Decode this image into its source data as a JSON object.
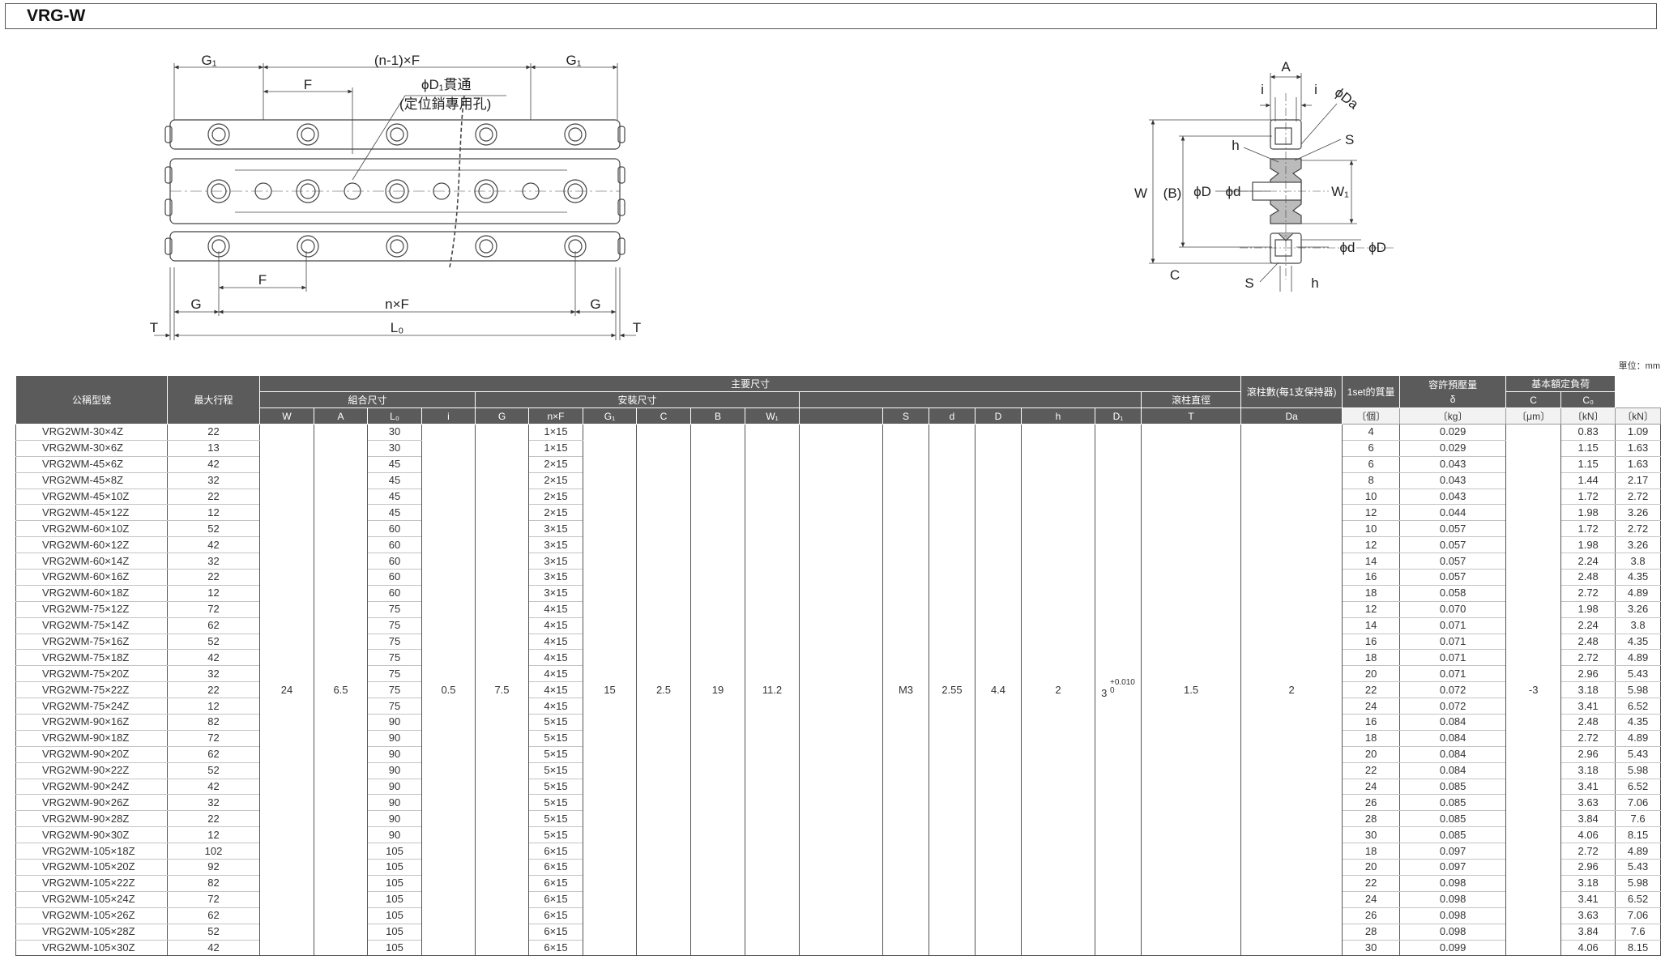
{
  "page_title": "VRG-W",
  "unit_label": "單位：mm",
  "drawing_labels": {
    "g1": "G₁",
    "n1f": "(n-1)×F",
    "f": "F",
    "d1": "ϕD₁貫通",
    "d1_note": "(定位銷專用孔)",
    "g": "G",
    "nxf": "n×F",
    "l0": "L₀",
    "t": "T",
    "a": "A",
    "i": "i",
    "da": "ϕDa",
    "h": "h",
    "s": "S",
    "w": "W",
    "b": "(B)",
    "phi_d_big": "ϕD",
    "phi_d_small": "ϕd",
    "w1": "W₁",
    "c": "C"
  },
  "headers": {
    "model": "公稱型號",
    "stroke": "最大行程",
    "main_dims": "主要尺寸",
    "assembly": "組合尺寸",
    "mounting": "安裝尺寸",
    "roller_dia": "滾柱直徑",
    "roller_count": "滾柱數(每1支保持器)",
    "roller_count_unit": "〔個〕",
    "mass": "1set的質量",
    "mass_unit": "〔kg〕",
    "preload": "容許預壓量",
    "preload_sym": "δ",
    "preload_unit": "〔μm〕",
    "load": "基本額定負荷",
    "load_unit": "〔kN〕",
    "cols": [
      "W",
      "A",
      "L₀",
      "i",
      "G",
      "n×F",
      "G₁",
      "C",
      "B",
      "W₁",
      "S",
      "d",
      "D",
      "h",
      "D₁",
      "T",
      "Da",
      "C",
      "C₀"
    ]
  },
  "common": {
    "W": "24",
    "A": "6.5",
    "i": "0.5",
    "G": "7.5",
    "G1": "15",
    "C": "2.5",
    "B": "19",
    "W1": "11.2",
    "S": "M3",
    "d": "2.55",
    "D": "4.4",
    "h": "2",
    "D1_base": "3",
    "D1_tol_upper": "+0.010",
    "D1_tol_lower": "0",
    "T": "1.5",
    "Da": "2",
    "preload": "-3"
  },
  "rows": [
    {
      "model": "VRG2WM-30×4Z",
      "stroke": "22",
      "L0": "30",
      "nF": "1×15",
      "count": "4",
      "mass": "0.029",
      "C": "0.83",
      "C0": "1.09"
    },
    {
      "model": "VRG2WM-30×6Z",
      "stroke": "13",
      "L0": "30",
      "nF": "1×15",
      "count": "6",
      "mass": "0.029",
      "C": "1.15",
      "C0": "1.63"
    },
    {
      "model": "VRG2WM-45×6Z",
      "stroke": "42",
      "L0": "45",
      "nF": "2×15",
      "count": "6",
      "mass": "0.043",
      "C": "1.15",
      "C0": "1.63"
    },
    {
      "model": "VRG2WM-45×8Z",
      "stroke": "32",
      "L0": "45",
      "nF": "2×15",
      "count": "8",
      "mass": "0.043",
      "C": "1.44",
      "C0": "2.17"
    },
    {
      "model": "VRG2WM-45×10Z",
      "stroke": "22",
      "L0": "45",
      "nF": "2×15",
      "count": "10",
      "mass": "0.043",
      "C": "1.72",
      "C0": "2.72"
    },
    {
      "model": "VRG2WM-45×12Z",
      "stroke": "12",
      "L0": "45",
      "nF": "2×15",
      "count": "12",
      "mass": "0.044",
      "C": "1.98",
      "C0": "3.26"
    },
    {
      "model": "VRG2WM-60×10Z",
      "stroke": "52",
      "L0": "60",
      "nF": "3×15",
      "count": "10",
      "mass": "0.057",
      "C": "1.72",
      "C0": "2.72"
    },
    {
      "model": "VRG2WM-60×12Z",
      "stroke": "42",
      "L0": "60",
      "nF": "3×15",
      "count": "12",
      "mass": "0.057",
      "C": "1.98",
      "C0": "3.26"
    },
    {
      "model": "VRG2WM-60×14Z",
      "stroke": "32",
      "L0": "60",
      "nF": "3×15",
      "count": "14",
      "mass": "0.057",
      "C": "2.24",
      "C0": "3.8"
    },
    {
      "model": "VRG2WM-60×16Z",
      "stroke": "22",
      "L0": "60",
      "nF": "3×15",
      "count": "16",
      "mass": "0.057",
      "C": "2.48",
      "C0": "4.35"
    },
    {
      "model": "VRG2WM-60×18Z",
      "stroke": "12",
      "L0": "60",
      "nF": "3×15",
      "count": "18",
      "mass": "0.058",
      "C": "2.72",
      "C0": "4.89"
    },
    {
      "model": "VRG2WM-75×12Z",
      "stroke": "72",
      "L0": "75",
      "nF": "4×15",
      "count": "12",
      "mass": "0.070",
      "C": "1.98",
      "C0": "3.26"
    },
    {
      "model": "VRG2WM-75×14Z",
      "stroke": "62",
      "L0": "75",
      "nF": "4×15",
      "count": "14",
      "mass": "0.071",
      "C": "2.24",
      "C0": "3.8"
    },
    {
      "model": "VRG2WM-75×16Z",
      "stroke": "52",
      "L0": "75",
      "nF": "4×15",
      "count": "16",
      "mass": "0.071",
      "C": "2.48",
      "C0": "4.35"
    },
    {
      "model": "VRG2WM-75×18Z",
      "stroke": "42",
      "L0": "75",
      "nF": "4×15",
      "count": "18",
      "mass": "0.071",
      "C": "2.72",
      "C0": "4.89"
    },
    {
      "model": "VRG2WM-75×20Z",
      "stroke": "32",
      "L0": "75",
      "nF": "4×15",
      "count": "20",
      "mass": "0.071",
      "C": "2.96",
      "C0": "5.43"
    },
    {
      "model": "VRG2WM-75×22Z",
      "stroke": "22",
      "L0": "75",
      "nF": "4×15",
      "count": "22",
      "mass": "0.072",
      "C": "3.18",
      "C0": "5.98"
    },
    {
      "model": "VRG2WM-75×24Z",
      "stroke": "12",
      "L0": "75",
      "nF": "4×15",
      "count": "24",
      "mass": "0.072",
      "C": "3.41",
      "C0": "6.52"
    },
    {
      "model": "VRG2WM-90×16Z",
      "stroke": "82",
      "L0": "90",
      "nF": "5×15",
      "count": "16",
      "mass": "0.084",
      "C": "2.48",
      "C0": "4.35"
    },
    {
      "model": "VRG2WM-90×18Z",
      "stroke": "72",
      "L0": "90",
      "nF": "5×15",
      "count": "18",
      "mass": "0.084",
      "C": "2.72",
      "C0": "4.89"
    },
    {
      "model": "VRG2WM-90×20Z",
      "stroke": "62",
      "L0": "90",
      "nF": "5×15",
      "count": "20",
      "mass": "0.084",
      "C": "2.96",
      "C0": "5.43"
    },
    {
      "model": "VRG2WM-90×22Z",
      "stroke": "52",
      "L0": "90",
      "nF": "5×15",
      "count": "22",
      "mass": "0.084",
      "C": "3.18",
      "C0": "5.98"
    },
    {
      "model": "VRG2WM-90×24Z",
      "stroke": "42",
      "L0": "90",
      "nF": "5×15",
      "count": "24",
      "mass": "0.085",
      "C": "3.41",
      "C0": "6.52"
    },
    {
      "model": "VRG2WM-90×26Z",
      "stroke": "32",
      "L0": "90",
      "nF": "5×15",
      "count": "26",
      "mass": "0.085",
      "C": "3.63",
      "C0": "7.06"
    },
    {
      "model": "VRG2WM-90×28Z",
      "stroke": "22",
      "L0": "90",
      "nF": "5×15",
      "count": "28",
      "mass": "0.085",
      "C": "3.84",
      "C0": "7.6"
    },
    {
      "model": "VRG2WM-90×30Z",
      "stroke": "12",
      "L0": "90",
      "nF": "5×15",
      "count": "30",
      "mass": "0.085",
      "C": "4.06",
      "C0": "8.15"
    },
    {
      "model": "VRG2WM-105×18Z",
      "stroke": "102",
      "L0": "105",
      "nF": "6×15",
      "count": "18",
      "mass": "0.097",
      "C": "2.72",
      "C0": "4.89"
    },
    {
      "model": "VRG2WM-105×20Z",
      "stroke": "92",
      "L0": "105",
      "nF": "6×15",
      "count": "20",
      "mass": "0.097",
      "C": "2.96",
      "C0": "5.43"
    },
    {
      "model": "VRG2WM-105×22Z",
      "stroke": "82",
      "L0": "105",
      "nF": "6×15",
      "count": "22",
      "mass": "0.098",
      "C": "3.18",
      "C0": "5.98"
    },
    {
      "model": "VRG2WM-105×24Z",
      "stroke": "72",
      "L0": "105",
      "nF": "6×15",
      "count": "24",
      "mass": "0.098",
      "C": "3.41",
      "C0": "6.52"
    },
    {
      "model": "VRG2WM-105×26Z",
      "stroke": "62",
      "L0": "105",
      "nF": "6×15",
      "count": "26",
      "mass": "0.098",
      "C": "3.63",
      "C0": "7.06"
    },
    {
      "model": "VRG2WM-105×28Z",
      "stroke": "52",
      "L0": "105",
      "nF": "6×15",
      "count": "28",
      "mass": "0.098",
      "C": "3.84",
      "C0": "7.6"
    },
    {
      "model": "VRG2WM-105×30Z",
      "stroke": "42",
      "L0": "105",
      "nF": "6×15",
      "count": "30",
      "mass": "0.099",
      "C": "4.06",
      "C0": "8.15"
    }
  ]
}
